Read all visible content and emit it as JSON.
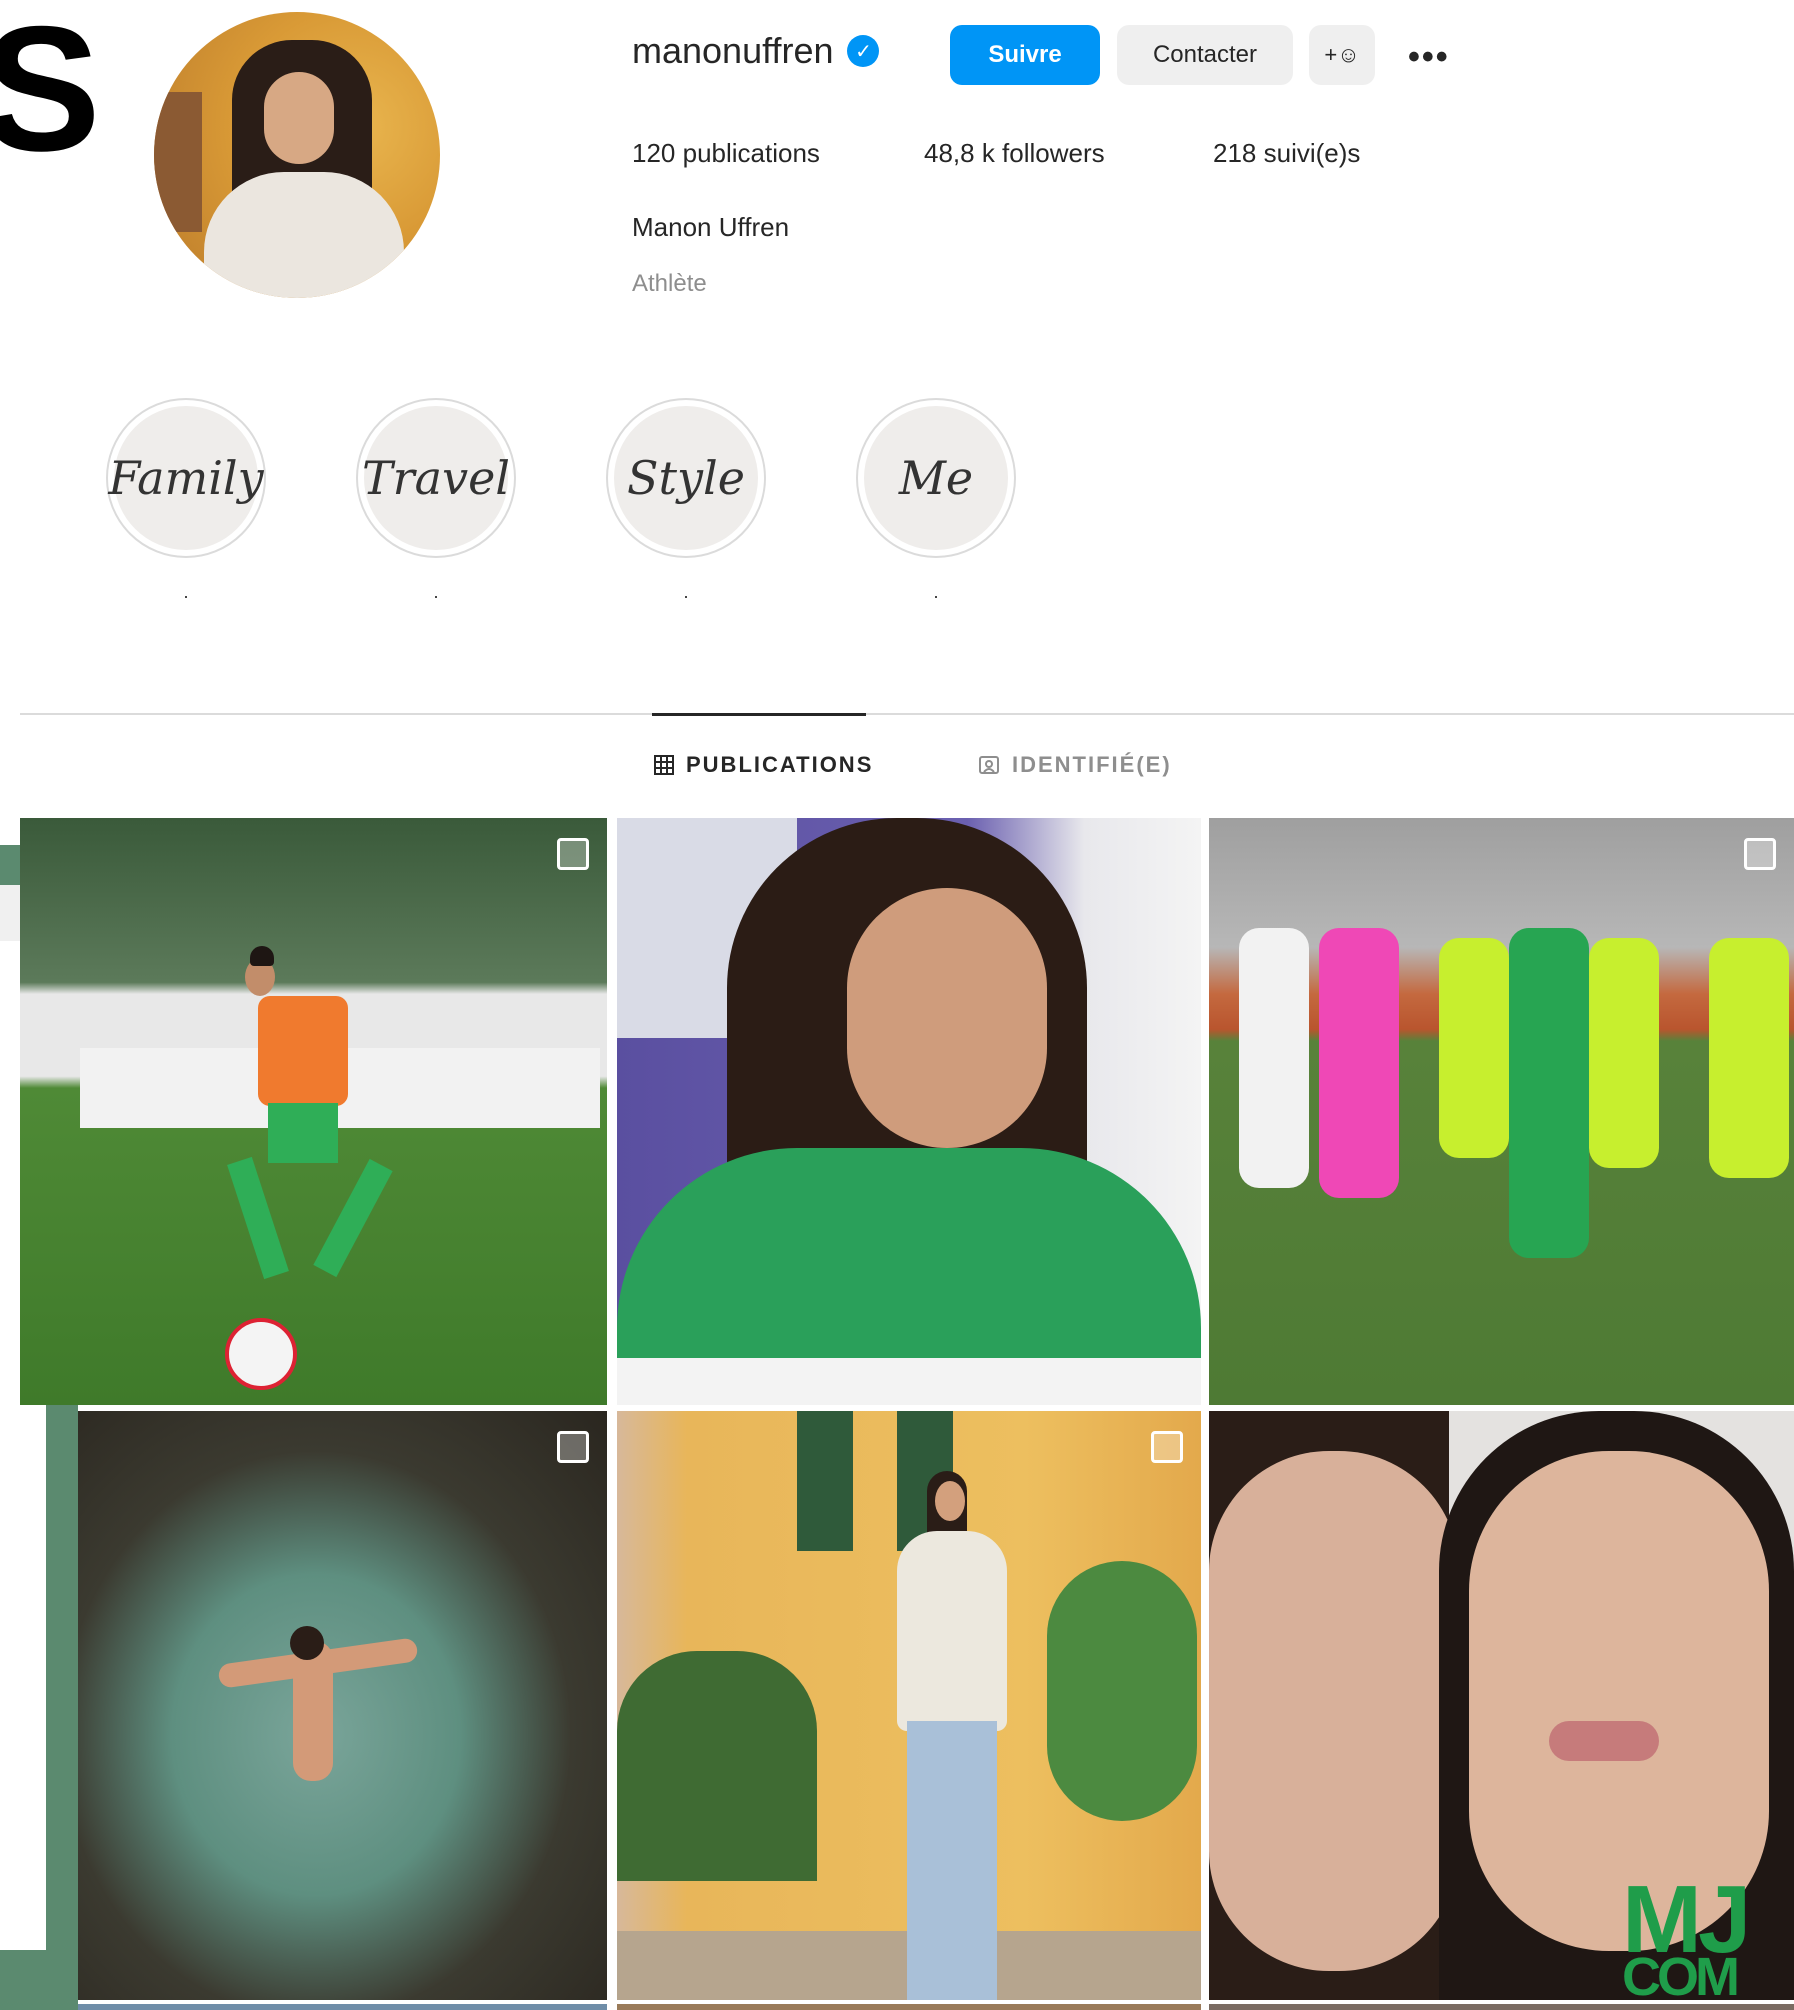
{
  "profile": {
    "username": "manonuffren",
    "follow_label": "Suivre",
    "contact_label": "Contacter",
    "add_user_glyph": "+☺",
    "more_glyph": "•••",
    "posts": "120 publications",
    "followers": "48,8 k followers",
    "following": "218 suivi(e)s",
    "full_name": "Manon Uffren",
    "category": "Athlète"
  },
  "highlights": [
    {
      "title": "Family",
      "label": "."
    },
    {
      "title": "Travel",
      "label": "."
    },
    {
      "title": "Style",
      "label": "."
    },
    {
      "title": "Me",
      "label": "."
    }
  ],
  "tabs": {
    "publications": "PUBLICATIONS",
    "tagged": "IDENTIFIÉ(E)"
  },
  "left_edge": {
    "letter": "S"
  },
  "watermark": {
    "letters": "MJ",
    "suffix": "COM"
  },
  "colors": {
    "accent": "#0095f6",
    "text": "#262626",
    "muted": "#8e8e8e",
    "border": "#dbdbdb",
    "watermark": "#1f9d4a"
  },
  "icons": [
    "verified-badge-icon",
    "add-user-icon",
    "more-icon",
    "grid-icon",
    "tagged-icon",
    "multi-post-icon"
  ]
}
